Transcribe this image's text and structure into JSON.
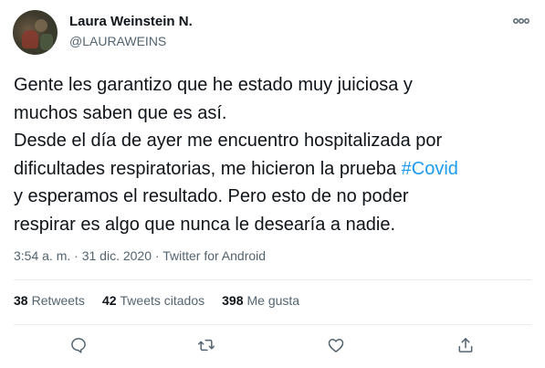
{
  "user": {
    "display_name": "Laura Weinstein N.",
    "handle": "@LAURAWEINS"
  },
  "tweet": {
    "text_part1": "Gente les garantizo que he estado muy juiciosa y\nmuchos saben que es así.\nDesde el día de ayer me encuentro hospitalizada por\ndificultades respiratorias, me hicieron la prueba ",
    "hashtag": "#Covid",
    "text_part2": "\ny esperamos el resultado. Pero esto de no poder\nrespirar es algo que nunca le desearía a nadie."
  },
  "meta": {
    "time": "3:54 a. m.",
    "separator1": " · ",
    "date": "31 dic. 2020",
    "separator2": " · ",
    "source": "Twitter for Android"
  },
  "stats": {
    "retweets_count": "38",
    "retweets_label": "Retweets",
    "quotes_count": "42",
    "quotes_label": "Tweets citados",
    "likes_count": "398",
    "likes_label": "Me gusta"
  },
  "icons": {
    "more": "more-horizontal-icon",
    "reply": "reply-icon",
    "retweet": "retweet-icon",
    "like": "heart-icon",
    "share": "share-icon"
  },
  "colors": {
    "accent": "#1d9bf0",
    "secondary_text": "#536471",
    "primary_text": "#0f1419"
  }
}
